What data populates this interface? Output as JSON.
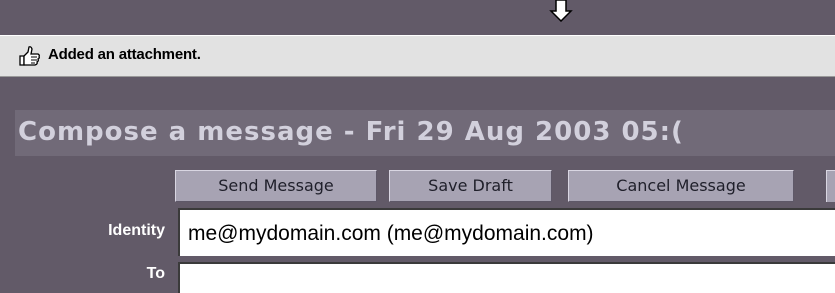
{
  "notice": {
    "icon": "thumbs-up-icon",
    "text": "Added an attachment."
  },
  "compose": {
    "title": "Compose a message - Fri 29 Aug 2003 05:("
  },
  "toolbar": {
    "send_label": "Send Message",
    "save_label": "Save Draft",
    "cancel_label": "Cancel Message"
  },
  "form": {
    "identity_label": "Identity",
    "identity_value": "me@mydomain.com (me@mydomain.com)",
    "to_label": "To",
    "to_value": ""
  },
  "colors": {
    "background": "#625a68",
    "title_bar": "#716a78",
    "title_text": "#d2d0dc",
    "button": "#a7a3b3",
    "notice_bar": "#e2e2e2"
  },
  "icons": {
    "top": "down-arrow-icon",
    "notice": "thumbs-up-icon"
  }
}
